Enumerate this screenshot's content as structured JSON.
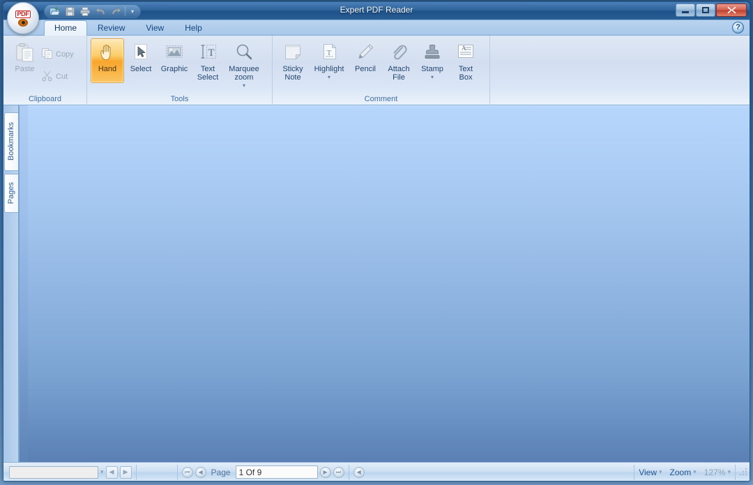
{
  "window": {
    "title": "Expert PDF Reader",
    "controls": {
      "minimize": "–",
      "maximize": "□",
      "close": "✕"
    }
  },
  "quick_access": {
    "items": [
      {
        "name": "open-icon",
        "label": "Open"
      },
      {
        "name": "save-icon",
        "label": "Save"
      },
      {
        "name": "print-icon",
        "label": "Print"
      },
      {
        "name": "undo-icon",
        "label": "Undo"
      },
      {
        "name": "redo-icon",
        "label": "Redo"
      }
    ],
    "dropdown": "▾"
  },
  "tabs": [
    {
      "label": "Home",
      "active": true
    },
    {
      "label": "Review",
      "active": false
    },
    {
      "label": "View",
      "active": false
    },
    {
      "label": "Help",
      "active": false
    }
  ],
  "help_button": "?",
  "ribbon": {
    "groups": [
      {
        "label": "Clipboard",
        "buttons": [
          {
            "label": "Paste",
            "icon": "paste-icon",
            "state": "disabled"
          },
          {
            "label": "Copy",
            "icon": "copy-icon",
            "state": "disabled"
          },
          {
            "label": "Cut",
            "icon": "cut-icon",
            "state": "disabled"
          }
        ]
      },
      {
        "label": "Tools",
        "buttons": [
          {
            "label": "Hand",
            "icon": "hand-icon",
            "state": "active"
          },
          {
            "label": "Select",
            "icon": "arrow-cursor-icon",
            "state": "normal"
          },
          {
            "label": "Graphic",
            "icon": "graphic-icon",
            "state": "normal"
          },
          {
            "label": "Text\nSelect",
            "icon": "text-select-icon",
            "state": "normal"
          },
          {
            "label": "Marquee\nzoom",
            "icon": "magnifier-icon",
            "state": "normal",
            "caret": "▾"
          }
        ]
      },
      {
        "label": "Comment",
        "buttons": [
          {
            "label": "Sticky\nNote",
            "icon": "sticky-note-icon",
            "state": "normal"
          },
          {
            "label": "Highlight",
            "icon": "highlight-icon",
            "state": "normal",
            "caret": "▾"
          },
          {
            "label": "Pencil",
            "icon": "pencil-icon",
            "state": "normal"
          },
          {
            "label": "Attach\nFile",
            "icon": "paperclip-icon",
            "state": "normal"
          },
          {
            "label": "Stamp",
            "icon": "stamp-icon",
            "state": "normal",
            "caret": "▾"
          },
          {
            "label": "Text\nBox",
            "icon": "text-box-icon",
            "state": "normal"
          }
        ]
      }
    ]
  },
  "sidebar": {
    "tabs": [
      {
        "label": "Bookmarks"
      },
      {
        "label": "Pages"
      }
    ]
  },
  "statusbar": {
    "find_value": "",
    "find_placeholder": "",
    "find_dropdown": "▾",
    "find_prev": "◀",
    "find_next": "▶",
    "first_page": "⏮",
    "prev_page": "◀",
    "page_label": "Page",
    "page_value": "1 Of 9",
    "next_page": "▶",
    "last_page": "⏭",
    "back": "◀",
    "view_label": "View",
    "view_caret": "▾",
    "zoom_label": "Zoom",
    "zoom_caret": "▾",
    "zoom_value": "127%",
    "zoom_value_caret": "▾"
  },
  "colors": {
    "accent_orange": "#f8a62d",
    "title_blue": "#2d6399",
    "close_red": "#bf3f2d",
    "viewport_top": "#b8d6fc",
    "viewport_bottom": "#5a80b4",
    "ribbon_label": "#3f6fa5"
  }
}
